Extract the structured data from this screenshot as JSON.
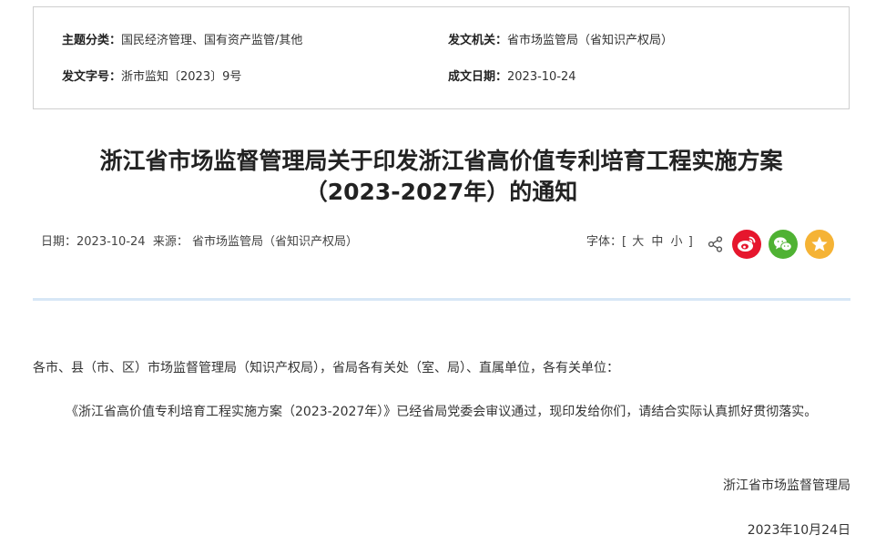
{
  "meta": {
    "topic_label": "主题分类：",
    "topic_value": "国民经济管理、国有资产监管/其他",
    "issuer_label": "发文机关：",
    "issuer_value": "省市场监管局（省知识产权局）",
    "docno_label": "发文字号：",
    "docno_value": "浙市监知〔2023〕9号",
    "date_label": "成文日期：",
    "date_value": "2023-10-24"
  },
  "article": {
    "title_line1": "浙江省市场监督管理局关于印发浙江省高价值专利培育工程实施方案",
    "title_line2": "（2023-2027年）的通知"
  },
  "info": {
    "date_label": "日期：",
    "date": "2023-10-24",
    "source_label": "来源：",
    "source": "省市场监管局（省知识产权局）",
    "font_label": "字体：",
    "bracket_open": "[",
    "large": "大",
    "medium": "中",
    "small": "小",
    "bracket_close": "]"
  },
  "share": {
    "weibo_icon": "weibo-icon",
    "wechat_icon": "wechat-icon",
    "favorite_icon": "star-icon",
    "weibo_color": "#e6162d",
    "wechat_color": "#4fb233",
    "favorite_color": "#f5b335"
  },
  "content": {
    "salutation": "各市、县（市、区）市场监督管理局（知识产权局），省局各有关处（室、局）、直属单位，各有关单位：",
    "paragraph": "《浙江省高价值专利培育工程实施方案（2023-2027年）》已经省局党委会审议通过，现印发给你们，请结合实际认真抓好贯彻落实。",
    "signature": "浙江省市场监督管理局",
    "sign_date": "2023年10月24日"
  }
}
